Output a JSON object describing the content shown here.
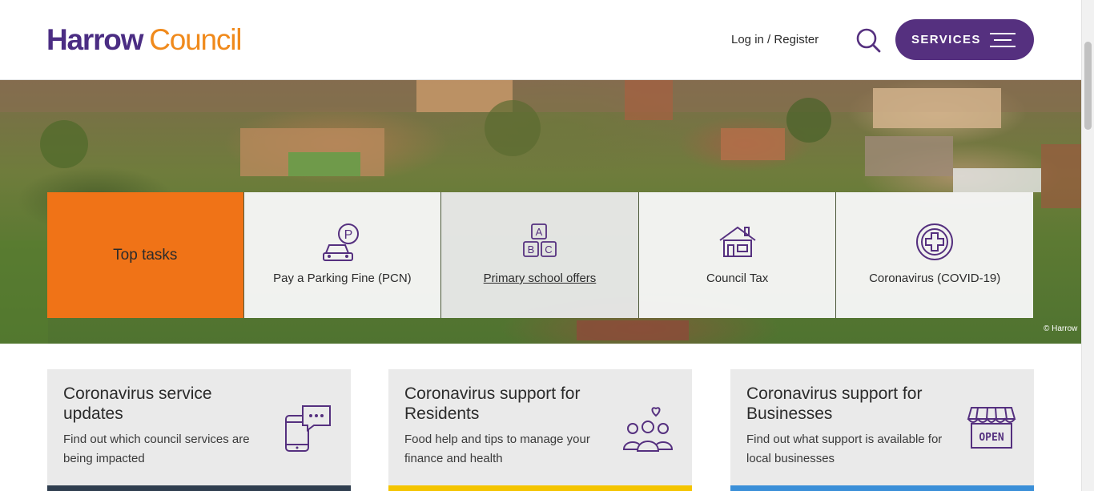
{
  "header": {
    "logo_primary": "Harrow",
    "logo_secondary": "Council",
    "login": "Log in",
    "separator": " / ",
    "register": "Register",
    "services_label": "SERVICES"
  },
  "hero": {
    "credit": "© Harrow"
  },
  "top_tasks": {
    "heading": "Top tasks",
    "items": [
      {
        "label": "Pay a Parking Fine (PCN)",
        "icon": "parking-car-icon"
      },
      {
        "label": "Primary school offers",
        "icon": "abc-blocks-icon"
      },
      {
        "label": "Council Tax",
        "icon": "house-icon"
      },
      {
        "label": "Coronavirus (COVID-19)",
        "icon": "medical-cross-icon"
      }
    ]
  },
  "cards": [
    {
      "title": "Coronavirus service updates",
      "text": "Find out which council services are being impacted",
      "icon": "phone-chat-icon",
      "accent": "#2f3e4f"
    },
    {
      "title": "Coronavirus support for Residents",
      "text": "Food help and tips to manage your finance and health",
      "icon": "community-heart-icon",
      "accent": "#f4c400"
    },
    {
      "title": "Coronavirus support for Businesses",
      "text": "Find out what support is available for local businesses",
      "icon": "open-shop-icon",
      "accent": "#3a8fd8"
    }
  ],
  "colors": {
    "brand_purple": "#4b2d83",
    "brand_orange": "#f08a1c",
    "services_button": "#55307f",
    "top_tasks_bg": "#f07317"
  }
}
